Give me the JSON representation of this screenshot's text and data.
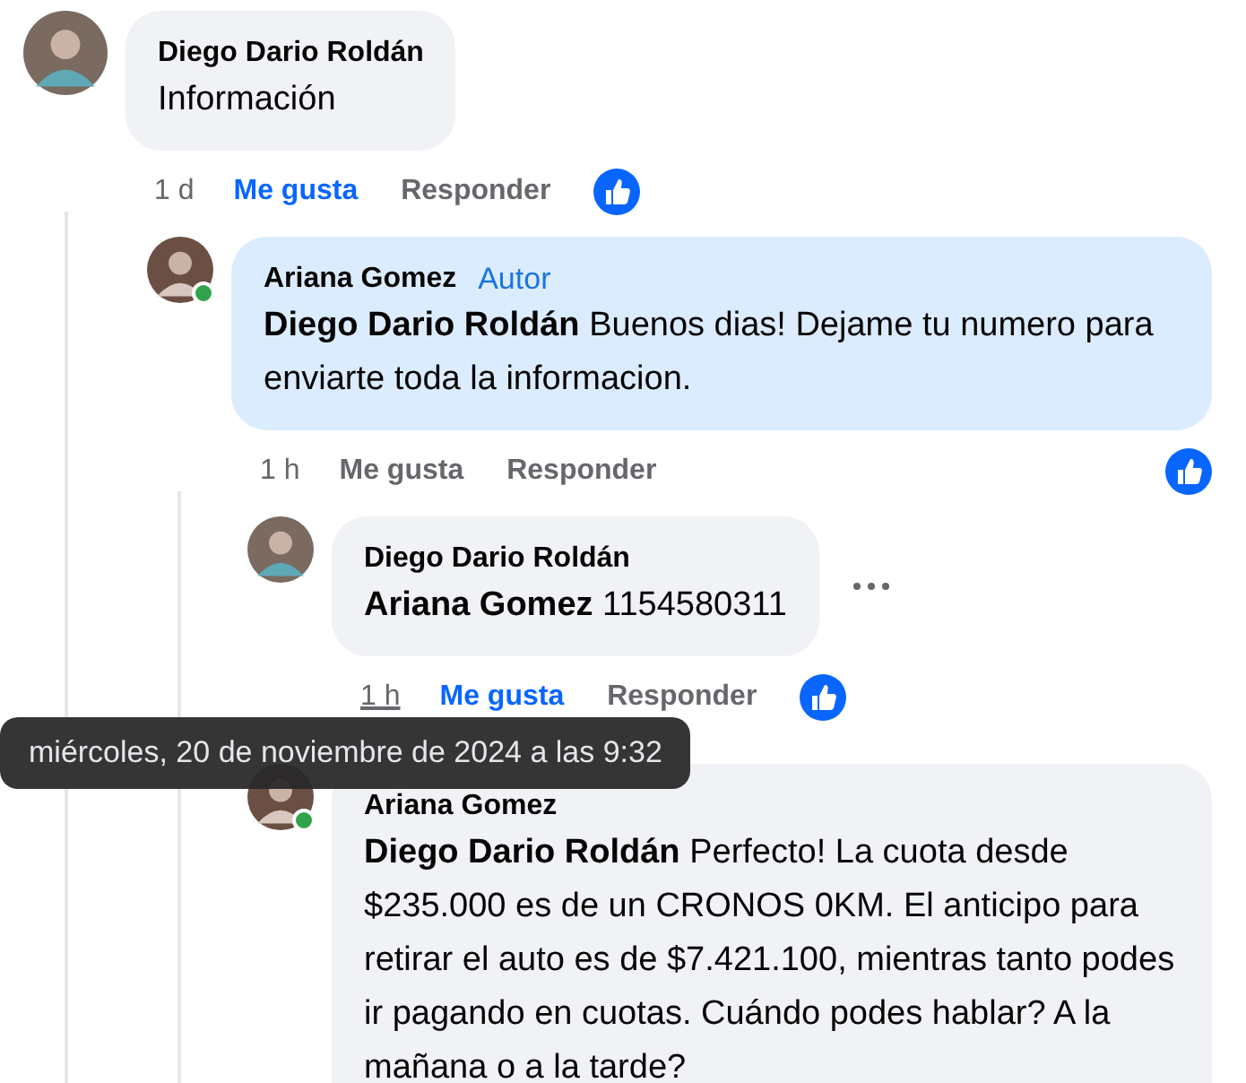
{
  "comments": [
    {
      "author": "Diego Dario Roldán",
      "text": "Información",
      "time": "1 d",
      "like_label": "Me gusta",
      "liked": true,
      "reply_label": "Responder",
      "reacted": true,
      "children": [
        {
          "author": "Ariana Gomez",
          "badge": "Autor",
          "online": true,
          "highlighted": true,
          "text": "**Diego Dario Roldán** Buenos dias! Dejame tu numero para enviarte toda la informacion.",
          "time": "1 h",
          "like_label": "Me gusta",
          "liked": false,
          "reply_label": "Responder",
          "reacted": true,
          "children": [
            {
              "author": "Diego Dario Roldán",
              "text": "**Ariana Gomez** 1154580311",
              "time": "1 h",
              "time_hovered": true,
              "like_label": "Me gusta",
              "liked": true,
              "reply_label": "Responder",
              "reacted": true,
              "show_more": true
            },
            {
              "author": "Ariana Gomez",
              "online": true,
              "text": "**Diego Dario Roldán** Perfecto! La cuota desde $235.000 es de un CRONOS 0KM. El anticipo para retirar el auto es de $7.421.100, mientras tanto podes ir pagando en cuotas. Cuándo podes hablar? A la mañana o a la tarde?"
            }
          ]
        }
      ]
    }
  ],
  "tooltip": "miércoles, 20 de noviembre de 2024 a las 9:32"
}
